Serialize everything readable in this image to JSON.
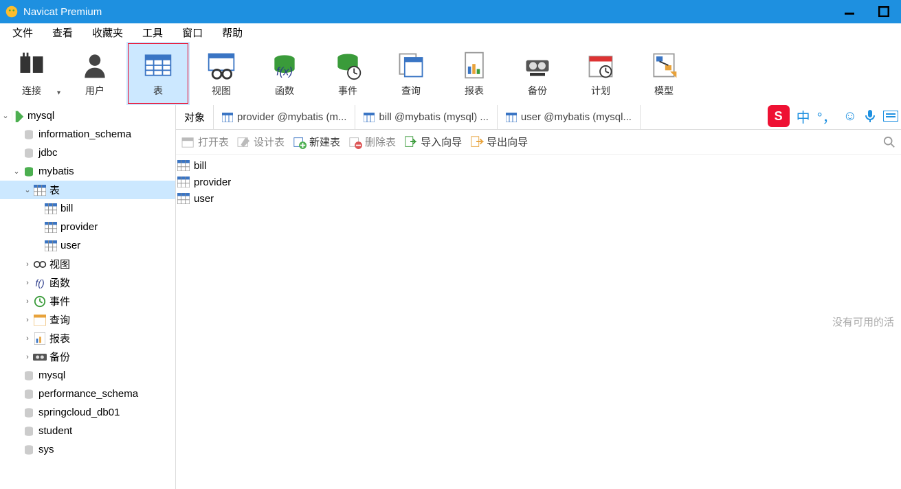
{
  "app": {
    "title": "Navicat Premium"
  },
  "menubar": [
    "文件",
    "查看",
    "收藏夹",
    "工具",
    "窗口",
    "帮助"
  ],
  "toolbar": [
    {
      "label": "连接",
      "icon": "plug",
      "chevron": true
    },
    {
      "label": "用户",
      "icon": "user"
    },
    {
      "label": "表",
      "icon": "table",
      "selected": true,
      "outline": true
    },
    {
      "label": "视图",
      "icon": "view"
    },
    {
      "label": "函数",
      "icon": "fx"
    },
    {
      "label": "事件",
      "icon": "event"
    },
    {
      "label": "查询",
      "icon": "query"
    },
    {
      "label": "报表",
      "icon": "report"
    },
    {
      "label": "备份",
      "icon": "backup"
    },
    {
      "label": "计划",
      "icon": "schedule"
    },
    {
      "label": "模型",
      "icon": "model"
    }
  ],
  "tree": {
    "root": "mysql",
    "databases": [
      {
        "name": "information_schema"
      },
      {
        "name": "jdbc"
      },
      {
        "name": "mybatis",
        "expanded": true,
        "groups": [
          {
            "label": "表",
            "icon": "table",
            "selected": true,
            "expanded": true,
            "children": [
              "bill",
              "provider",
              "user"
            ]
          },
          {
            "label": "视图",
            "icon": "view"
          },
          {
            "label": "函数",
            "icon": "fx"
          },
          {
            "label": "事件",
            "icon": "event"
          },
          {
            "label": "查询",
            "icon": "query"
          },
          {
            "label": "报表",
            "icon": "report"
          },
          {
            "label": "备份",
            "icon": "backup"
          }
        ]
      },
      {
        "name": "mysql"
      },
      {
        "name": "performance_schema"
      },
      {
        "name": "springcloud_db01"
      },
      {
        "name": "student"
      },
      {
        "name": "sys"
      }
    ]
  },
  "tabs": {
    "first": "对象",
    "others": [
      "provider @mybatis (m...",
      "bill @mybatis (mysql) ...",
      "user @mybatis (mysql..."
    ]
  },
  "actions": [
    {
      "label": "打开表",
      "icon": "open",
      "enabled": false
    },
    {
      "label": "设计表",
      "icon": "design",
      "enabled": false
    },
    {
      "label": "新建表",
      "icon": "new",
      "enabled": true
    },
    {
      "label": "删除表",
      "icon": "delete",
      "enabled": false
    },
    {
      "label": "导入向导",
      "icon": "import",
      "enabled": true
    },
    {
      "label": "导出向导",
      "icon": "export",
      "enabled": true
    }
  ],
  "table_items": [
    "bill",
    "provider",
    "user"
  ],
  "right_panel": {
    "text": "没有可用的活"
  },
  "ime": {
    "lang": "中"
  }
}
